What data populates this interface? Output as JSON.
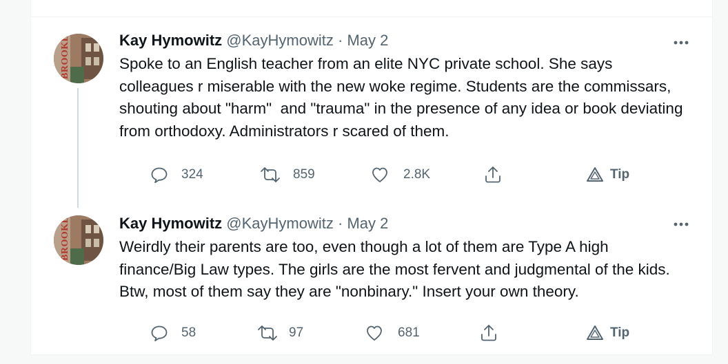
{
  "tweets": [
    {
      "author_name": "Kay Hymowitz",
      "handle": "@KayHymowitz",
      "separator": "·",
      "date": "May 2",
      "avatar_text": "BROOKLYN",
      "text": "Spoke to an English teacher from an elite NYC private school. She says colleagues r miserable with the new woke regime. Students are the commissars, shouting about \"harm\"  and \"trauma\" in the presence of any idea or book deviating from orthodoxy. Administrators r scared of them.",
      "reply_count": "324",
      "retweet_count": "859",
      "like_count": "2.8K",
      "tip_label": "Tip"
    },
    {
      "author_name": "Kay Hymowitz",
      "handle": "@KayHymowitz",
      "separator": "·",
      "date": "May 2",
      "avatar_text": "BROOKLYN",
      "text": "Weirdly their parents are too, even though a lot of them are Type A high finance/Big Law types. The girls are the most fervent and judgmental of the kids. Btw, most of them say they are \"nonbinary.\" Insert your own theory.",
      "reply_count": "58",
      "retweet_count": "97",
      "like_count": "681",
      "tip_label": "Tip"
    }
  ],
  "icons": {
    "reply": "reply-icon",
    "retweet": "retweet-icon",
    "like": "heart-icon",
    "share": "share-icon",
    "tip": "tip-icon",
    "more": "more-icon"
  },
  "colors": {
    "text": "#0f1419",
    "secondary": "#536471",
    "divider": "#eff3f4",
    "thread_line": "#cfd9de"
  }
}
